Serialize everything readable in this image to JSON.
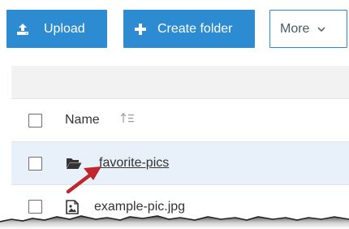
{
  "toolbar": {
    "upload_label": "Upload",
    "create_folder_label": "Create folder",
    "more_label": "More"
  },
  "table": {
    "columns": [
      {
        "label": "Name",
        "sort_icon": "sort-ascending-icon"
      }
    ],
    "rows": [
      {
        "name": "favorite-pics",
        "type": "folder",
        "icon": "folder-open-icon",
        "selected_highlight": true
      },
      {
        "name": "example-pic.jpg",
        "type": "image",
        "icon": "image-file-icon",
        "selected_highlight": false
      }
    ]
  },
  "colors": {
    "primary": "#2d8cd1",
    "row_highlight": "#e8f1f9",
    "annotation_arrow": "#c0262d"
  },
  "icons": {
    "upload": "upload-icon",
    "create_folder": "plus-icon",
    "more": "chevron-down-icon"
  }
}
